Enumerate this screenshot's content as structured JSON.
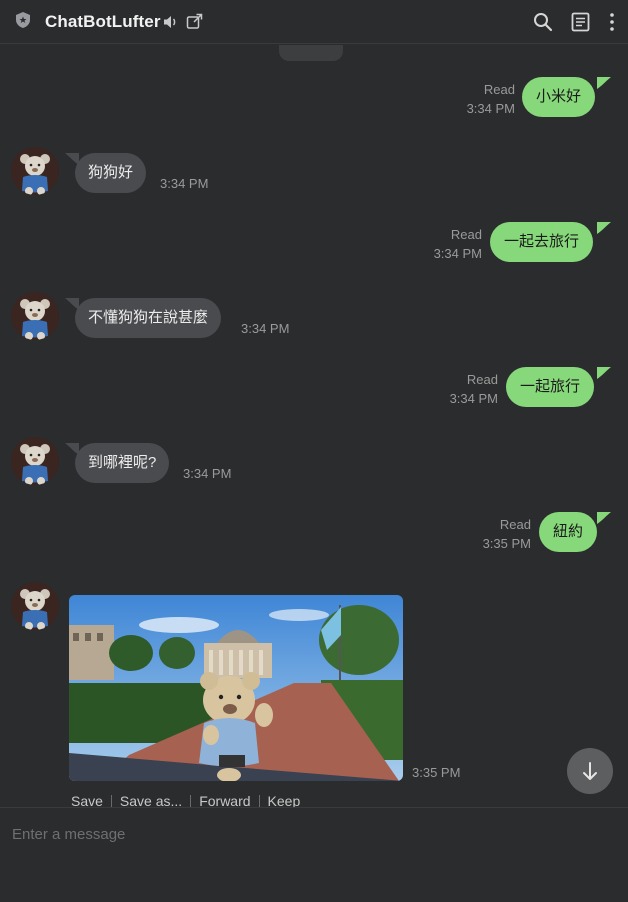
{
  "header": {
    "title": "ChatBotLufter",
    "icons": [
      "shield-icon",
      "volume-icon",
      "external-link-icon",
      "search-icon",
      "notes-icon",
      "more-vert-icon"
    ]
  },
  "messages": [
    {
      "dir": "out",
      "text": "小米好",
      "status": "Read",
      "time": "3:34 PM"
    },
    {
      "dir": "in",
      "text": "狗狗好",
      "time": "3:34 PM"
    },
    {
      "dir": "out",
      "text": "一起去旅行",
      "status": "Read",
      "time": "3:34 PM"
    },
    {
      "dir": "in",
      "text": "不懂狗狗在說甚麼",
      "time": "3:34 PM"
    },
    {
      "dir": "out",
      "text": "一起旅行",
      "status": "Read",
      "time": "3:34 PM"
    },
    {
      "dir": "in",
      "text": "到哪裡呢?",
      "time": "3:34 PM"
    },
    {
      "dir": "out",
      "text": "紐約",
      "status": "Read",
      "time": "3:35 PM"
    },
    {
      "dir": "in",
      "type": "image",
      "time": "3:35 PM"
    }
  ],
  "image_actions": [
    "Save",
    "Save as...",
    "Forward",
    "Keep"
  ],
  "input": {
    "placeholder": "Enter a message"
  },
  "colors": {
    "background": "#2b2c2e",
    "outgoing_bubble": "#87d87a",
    "incoming_bubble": "#4a4b4e"
  }
}
